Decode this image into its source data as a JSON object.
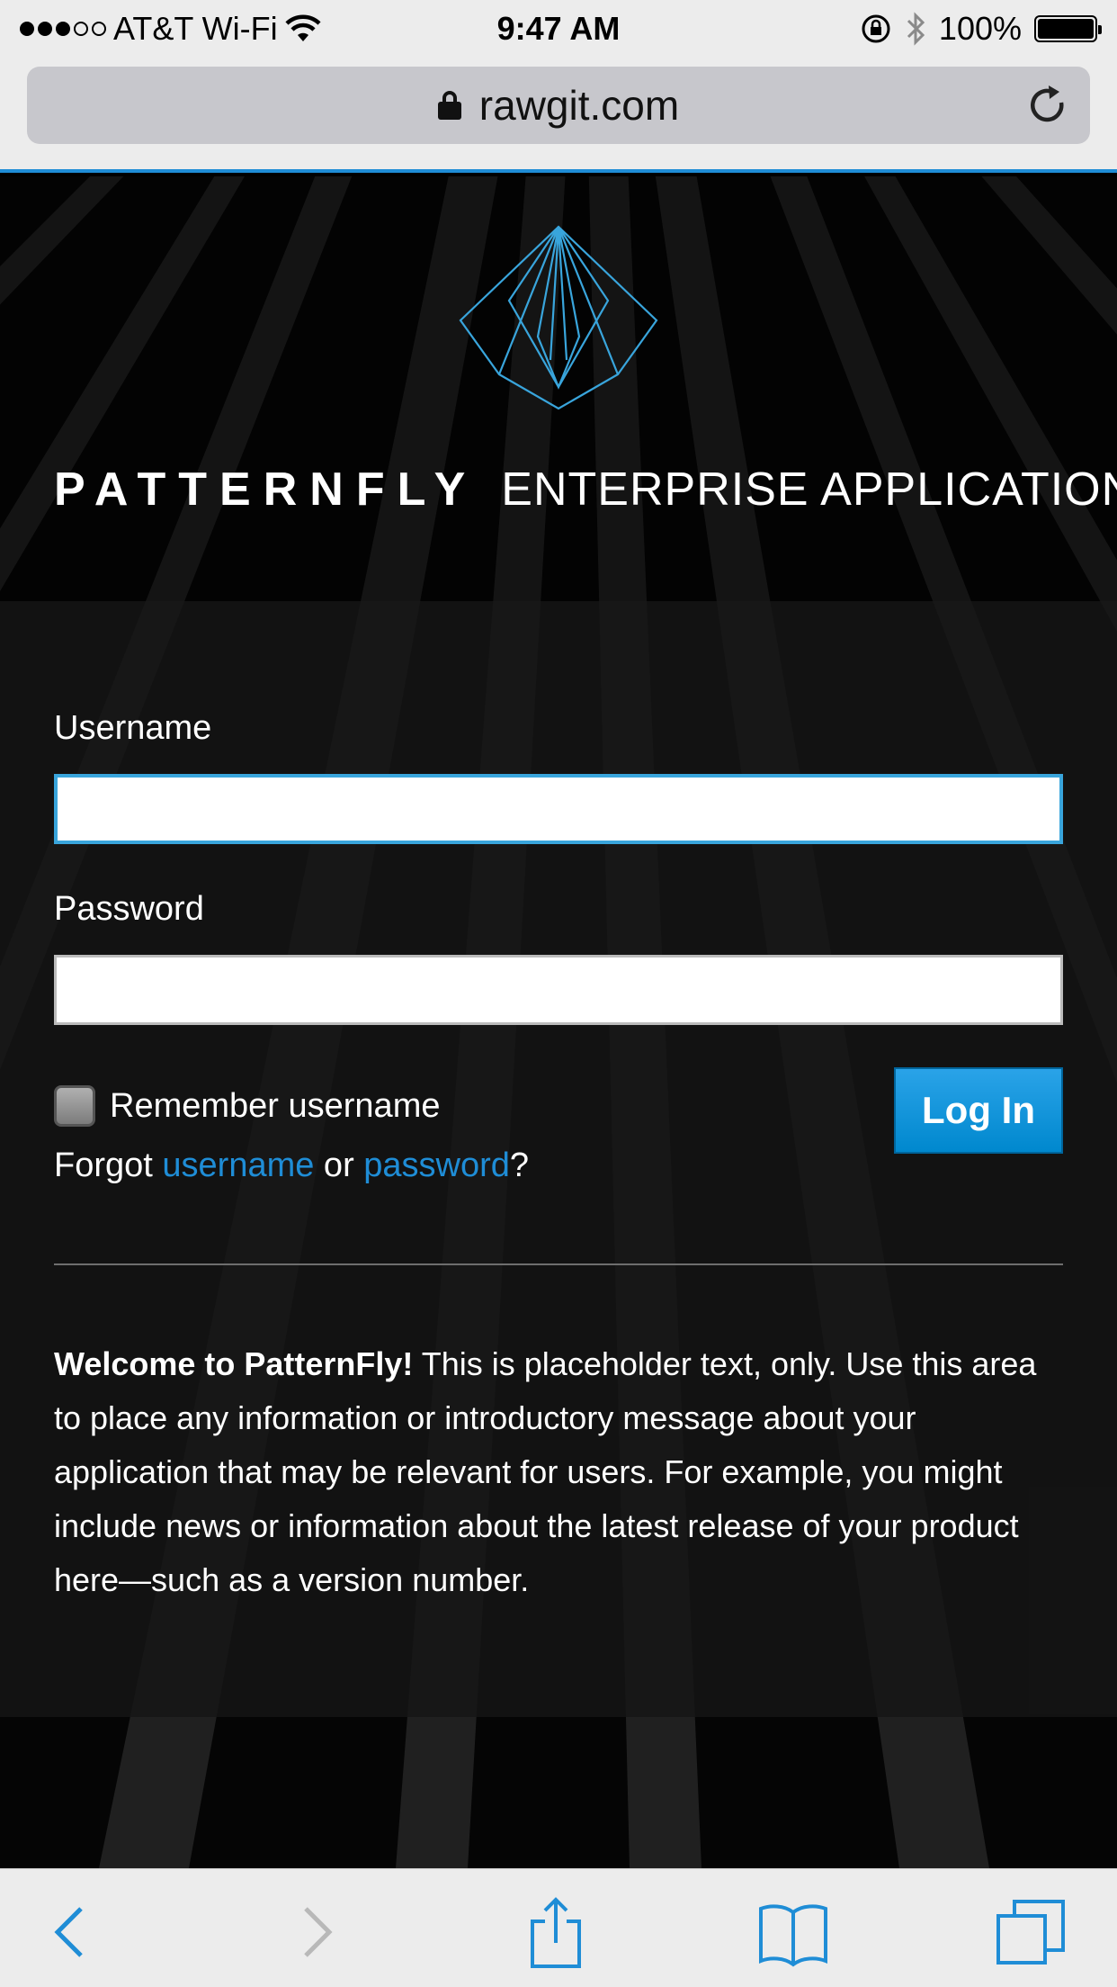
{
  "status_bar": {
    "carrier": "AT&T Wi-Fi",
    "time": "9:47 AM",
    "battery": "100%",
    "signal_bars_filled": 3,
    "signal_bars_total": 5
  },
  "url_bar": {
    "address": "rawgit.com"
  },
  "header": {
    "brand_strong": "PATTERNFLY",
    "brand_light": "ENTERPRISE APPLICATION"
  },
  "form": {
    "username_label": "Username",
    "username_value": "",
    "password_label": "Password",
    "password_value": "",
    "remember_label": "Remember username",
    "forgot_prefix": "Forgot ",
    "forgot_username": "username",
    "forgot_or": " or ",
    "forgot_password": "password",
    "forgot_suffix": "?",
    "login_label": "Log In"
  },
  "help": {
    "heading": "Welcome to PatternFly!",
    "body": " This is placeholder text, only. Use this area to place any information or introductory message about your application that may be relevant for users. For example, you might include news or information about the latest release of your product here—such as a version number."
  },
  "colors": {
    "accent": "#1f8dd6",
    "button": "#0088ce",
    "logo": "#39a5dc"
  },
  "toolbar": {
    "icons": [
      "back-icon",
      "forward-icon",
      "share-icon",
      "bookmarks-icon",
      "tabs-icon"
    ]
  }
}
